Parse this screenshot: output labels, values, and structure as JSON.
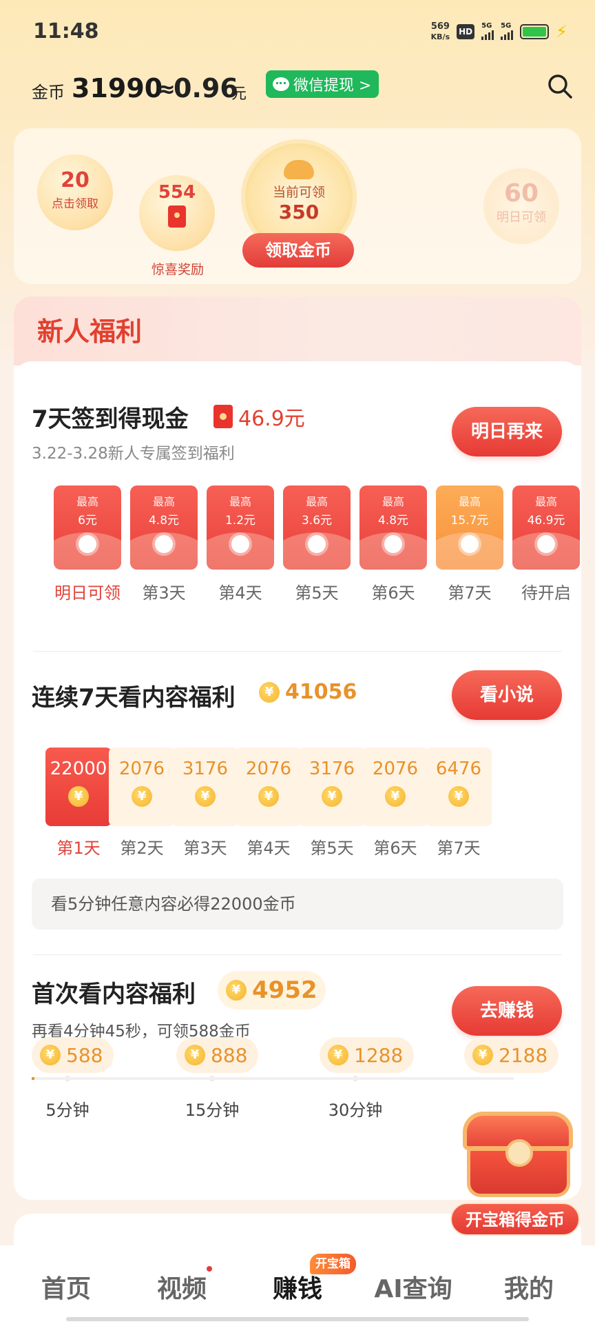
{
  "status_bar": {
    "time": "11:48",
    "net_speed": "569",
    "net_unit": "KB/s",
    "hd": "HD",
    "sig1": "5G",
    "sig2": "5G"
  },
  "header": {
    "coin_label": "金币",
    "coin_value": "31990",
    "approx": "≈",
    "money": "0.96",
    "yuan": "元",
    "wechat_btn": "微信提现 >"
  },
  "rewards": {
    "bubble1_num": "20",
    "bubble1_label": "点击领取",
    "bubble2_num": "554",
    "bubble2_label": "惊喜奖励",
    "main_label": "当前可领",
    "main_num": "350",
    "main_btn": "领取金币",
    "bubble4_num": "60",
    "bubble4_label": "明日可领"
  },
  "newbie": {
    "title": "新人福利",
    "checkin": {
      "title": "7天签到得现金",
      "amount": "46.9元",
      "subtitle": "3.22-3.28新人专属签到福利",
      "button": "明日再来",
      "days": [
        {
          "top": "最高",
          "amount": "6元",
          "label": "明日可领"
        },
        {
          "top": "最高",
          "amount": "4.8元",
          "label": "第3天"
        },
        {
          "top": "最高",
          "amount": "1.2元",
          "label": "第4天"
        },
        {
          "top": "最高",
          "amount": "3.6元",
          "label": "第5天"
        },
        {
          "top": "最高",
          "amount": "4.8元",
          "label": "第6天"
        },
        {
          "top": "最高",
          "amount": "15.7元",
          "label": "第7天"
        },
        {
          "top": "最高",
          "amount": "46.9元",
          "label": "待开启"
        }
      ]
    },
    "watch7": {
      "title": "连续7天看内容福利",
      "total": "41056",
      "button": "看小说",
      "days": [
        {
          "value": "22000",
          "label": "第1天"
        },
        {
          "value": "2076",
          "label": "第2天"
        },
        {
          "value": "3176",
          "label": "第3天"
        },
        {
          "value": "2076",
          "label": "第4天"
        },
        {
          "value": "3176",
          "label": "第5天"
        },
        {
          "value": "2076",
          "label": "第6天"
        },
        {
          "value": "6476",
          "label": "第7天"
        }
      ],
      "tip": "看5分钟任意内容必得22000金币"
    },
    "first_watch": {
      "title": "首次看内容福利",
      "total": "4952",
      "subtitle": "再看4分钟45秒，可领588金币",
      "button": "去赚钱",
      "progress": 0.0,
      "milestones": [
        {
          "coins": "588",
          "label": "5分钟"
        },
        {
          "coins": "888",
          "label": "15分钟"
        },
        {
          "coins": "1288",
          "label": "30分钟"
        },
        {
          "coins": "2188",
          "label": ""
        }
      ]
    }
  },
  "chest": {
    "label": "开宝箱得金币"
  },
  "nav": {
    "home": "首页",
    "video": "视频",
    "earn": "赚钱",
    "earn_badge": "开宝箱",
    "ai": "AI查询",
    "mine": "我的"
  },
  "colors": {
    "accent": "#e23d3a",
    "coin": "#e8922a",
    "wechat": "#1fb85a"
  }
}
